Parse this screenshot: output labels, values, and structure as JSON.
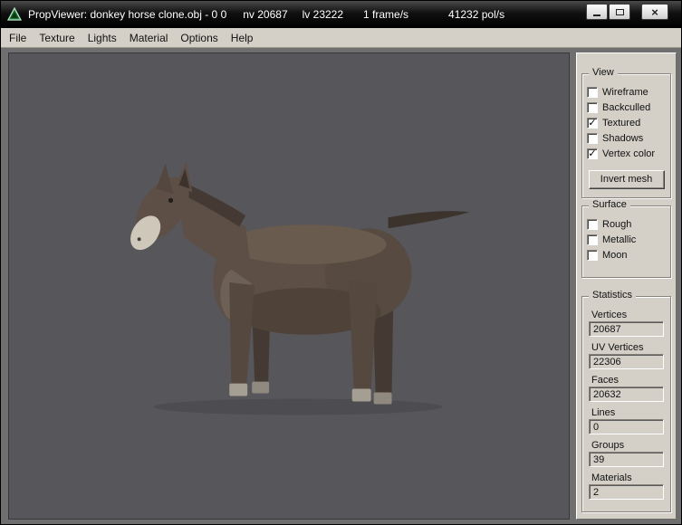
{
  "titlebar": {
    "title": "PropViewer: donkey horse clone.obj - 0 0",
    "stats": [
      "nv 20687",
      "lv 23222",
      "1 frame/s",
      "41232 pol/s"
    ],
    "close_glyph": "×"
  },
  "menu": {
    "items": [
      "File",
      "Texture",
      "Lights",
      "Material",
      "Options",
      "Help"
    ]
  },
  "panel": {
    "view": {
      "title": "View",
      "items": [
        {
          "label": "Wireframe",
          "mark": ""
        },
        {
          "label": "Backculled",
          "mark": ""
        },
        {
          "label": "Textured",
          "mark": "✓"
        },
        {
          "label": "Shadows",
          "mark": ""
        },
        {
          "label": "Vertex color",
          "mark": "✓"
        }
      ],
      "invert_button": "Invert mesh"
    },
    "surface": {
      "title": "Surface",
      "items": [
        {
          "label": "Rough",
          "mark": ""
        },
        {
          "label": "Metallic",
          "mark": ""
        },
        {
          "label": "Moon",
          "mark": ""
        }
      ]
    },
    "statistics": {
      "title": "Statistics",
      "fields": [
        {
          "label": "Vertices",
          "value": "20687"
        },
        {
          "label": "UV Vertices",
          "value": "22306"
        },
        {
          "label": "Faces",
          "value": "20632"
        },
        {
          "label": "Lines",
          "value": "0"
        },
        {
          "label": "Groups",
          "value": "39"
        },
        {
          "label": "Materials",
          "value": "2"
        }
      ]
    }
  },
  "colors": {
    "titlebar_bg": "#000000",
    "panel_bg": "#d4d0c8",
    "viewport_bg": "#57565b",
    "model_body": "#5d4f45",
    "model_muzzle": "#cfc7ba"
  }
}
